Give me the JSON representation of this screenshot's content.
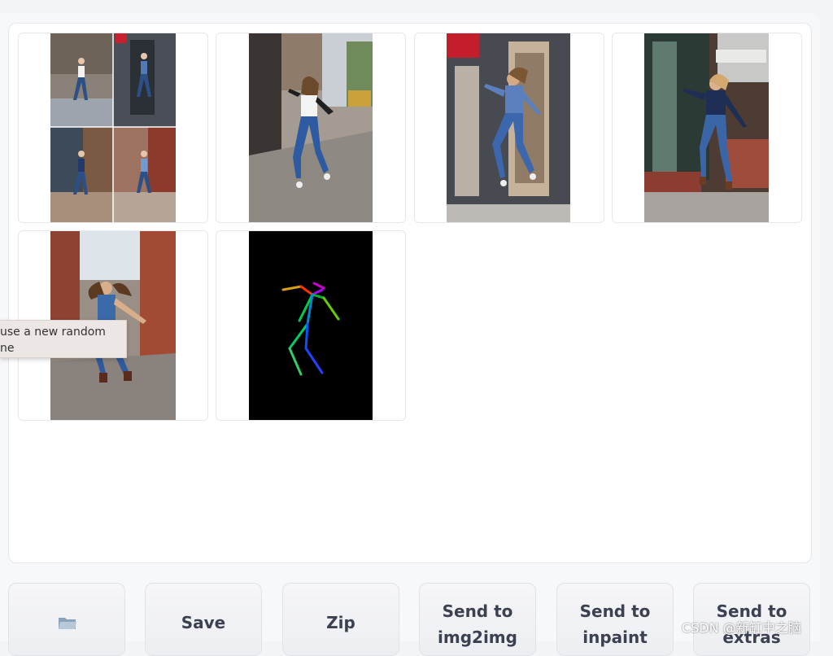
{
  "gallery": {
    "images": [
      {
        "name": "grid-composite",
        "kind": "grid"
      },
      {
        "name": "jumping-woman-white-top",
        "kind": "photo"
      },
      {
        "name": "jumping-woman-denim-store",
        "kind": "photo"
      },
      {
        "name": "jumping-woman-brick-shop",
        "kind": "photo"
      },
      {
        "name": "jumping-woman-alley",
        "kind": "photo"
      },
      {
        "name": "openpose-skeleton",
        "kind": "pose"
      }
    ]
  },
  "tooltip": {
    "line1": "use a new random",
    "line2": "ne"
  },
  "buttons": {
    "open_folder_icon": "folder-icon",
    "save": "Save",
    "zip": "Zip",
    "img2img_l1": "Send to",
    "img2img_l2": "img2img",
    "inpaint_l1": "Send to",
    "inpaint_l2": "inpaint",
    "extras_l1": "Send to",
    "extras_l2": "extras"
  },
  "watermark": "CSDN @新缸中之脑"
}
